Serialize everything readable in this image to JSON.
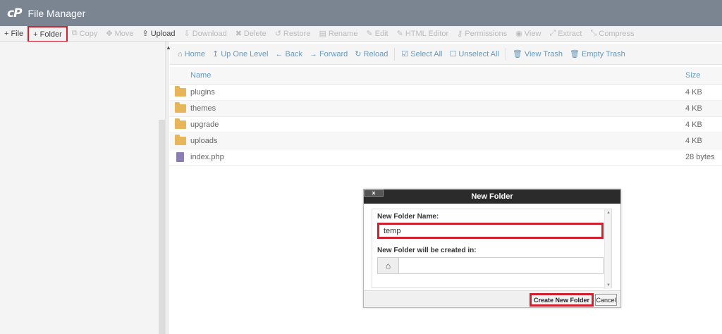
{
  "app": {
    "logo": "cP",
    "title": "File Manager"
  },
  "toolbar": [
    {
      "icon": "+",
      "label": "File",
      "enabled": true,
      "highlighted": false
    },
    {
      "icon": "+",
      "label": "Folder",
      "enabled": true,
      "highlighted": true
    },
    {
      "icon": "⧉",
      "label": "Copy",
      "enabled": false,
      "highlighted": false
    },
    {
      "icon": "✥",
      "label": "Move",
      "enabled": false,
      "highlighted": false
    },
    {
      "icon": "⇪",
      "label": "Upload",
      "enabled": true,
      "highlighted": false
    },
    {
      "icon": "⇩",
      "label": "Download",
      "enabled": false,
      "highlighted": false
    },
    {
      "icon": "✖",
      "label": "Delete",
      "enabled": false,
      "highlighted": false
    },
    {
      "icon": "↺",
      "label": "Restore",
      "enabled": false,
      "highlighted": false
    },
    {
      "icon": "▤",
      "label": "Rename",
      "enabled": false,
      "highlighted": false
    },
    {
      "icon": "✎",
      "label": "Edit",
      "enabled": false,
      "highlighted": false
    },
    {
      "icon": "✎",
      "label": "HTML Editor",
      "enabled": false,
      "highlighted": false
    },
    {
      "icon": "⚷",
      "label": "Permissions",
      "enabled": false,
      "highlighted": false
    },
    {
      "icon": "◉",
      "label": "View",
      "enabled": false,
      "highlighted": false
    },
    {
      "icon": "⤢",
      "label": "Extract",
      "enabled": false,
      "highlighted": false
    },
    {
      "icon": "⤡",
      "label": "Compress",
      "enabled": false,
      "highlighted": false
    }
  ],
  "navbar": [
    {
      "icon": "⌂",
      "label": "Home"
    },
    {
      "icon": "↥",
      "label": "Up One Level"
    },
    {
      "icon": "←",
      "label": "Back"
    },
    {
      "icon": "→",
      "label": "Forward"
    },
    {
      "icon": "↻",
      "label": "Reload"
    },
    {
      "icon": "☑",
      "label": "Select All"
    },
    {
      "icon": "☐",
      "label": "Unselect All"
    },
    {
      "icon": "🗑",
      "label": "View Trash"
    },
    {
      "icon": "🗑",
      "label": "Empty Trash"
    }
  ],
  "table": {
    "columns": {
      "name": "Name",
      "size": "Size"
    },
    "rows": [
      {
        "type": "folder",
        "name": "plugins",
        "size": "4 KB"
      },
      {
        "type": "folder",
        "name": "themes",
        "size": "4 KB"
      },
      {
        "type": "folder",
        "name": "upgrade",
        "size": "4 KB"
      },
      {
        "type": "folder",
        "name": "uploads",
        "size": "4 KB"
      },
      {
        "type": "file",
        "name": "index.php",
        "size": "28 bytes"
      }
    ]
  },
  "dialog": {
    "title": "New Folder",
    "close": "×",
    "name_label": "New Folder Name:",
    "name_value": "temp",
    "location_label": "New Folder will be created in:",
    "location_icon": "⌂",
    "location_value": "",
    "create_label": "Create New Folder",
    "cancel_label": "Cancel"
  },
  "colors": {
    "highlight": "#d0222e",
    "titlebar": "#7b8592",
    "link": "#6699bb",
    "folder": "#e8b65a"
  }
}
